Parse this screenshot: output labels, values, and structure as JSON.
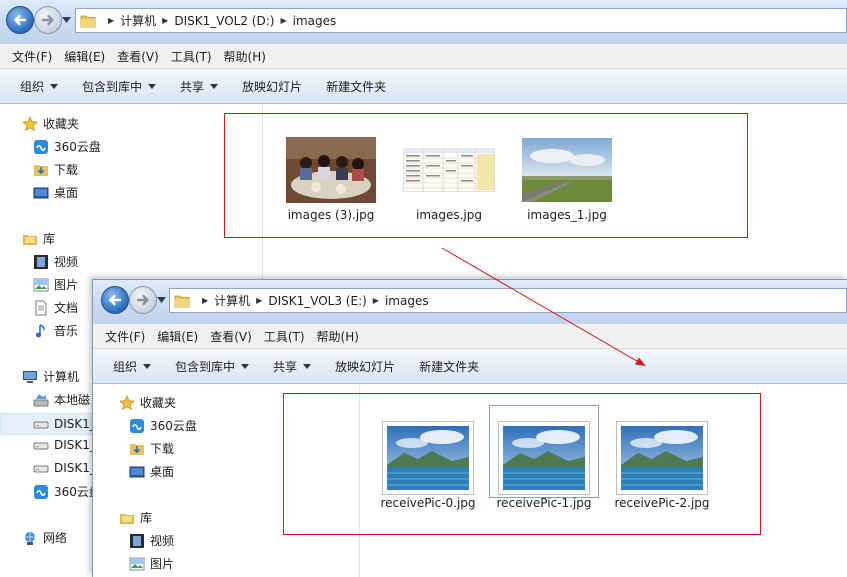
{
  "colors": {
    "annotation_red": "#cc1c1c",
    "title_blue": "#c9dbef",
    "selection_blue": "#e5f0fb"
  },
  "back_window": {
    "breadcrumb": [
      "计算机",
      "DISK1_VOL2 (D:)",
      "images"
    ],
    "menu": [
      "文件(F)",
      "编辑(E)",
      "查看(V)",
      "工具(T)",
      "帮助(H)"
    ],
    "toolbar": [
      "组织",
      "包含到库中",
      "共享",
      "放映幻灯片",
      "新建文件夹"
    ],
    "nav": {
      "favorites": "收藏夹",
      "cloud": "360云盘",
      "downloads": "下载",
      "desktop": "桌面",
      "libraries": "库",
      "videos": "视频",
      "pictures": "图片",
      "documents": "文档",
      "music": "音乐",
      "computer": "计算机",
      "local_disk": "本地磁",
      "disk1_a": "DISK1_",
      "disk1_b": "DISK1_",
      "disk1_c": "DISK1_",
      "cloud2": "360云盘",
      "network": "网络"
    },
    "files": [
      "images (3).jpg",
      "images.jpg",
      "images_1.jpg"
    ]
  },
  "front_window": {
    "breadcrumb": [
      "计算机",
      "DISK1_VOL3 (E:)",
      "images"
    ],
    "menu": [
      "文件(F)",
      "编辑(E)",
      "查看(V)",
      "工具(T)",
      "帮助(H)"
    ],
    "toolbar": [
      "组织",
      "包含到库中",
      "共享",
      "放映幻灯片",
      "新建文件夹"
    ],
    "nav": {
      "favorites": "收藏夹",
      "cloud": "360云盘",
      "downloads": "下载",
      "desktop": "桌面",
      "libraries": "库",
      "videos": "视频",
      "pictures": "图片"
    },
    "files": [
      "receivePic-0.jpg",
      "receivePic-1.jpg",
      "receivePic-2.jpg"
    ]
  },
  "icons": [
    "back-arrow-icon",
    "forward-arrow-icon",
    "folder-icon",
    "star-icon",
    "cloud-icon",
    "download-folder-icon",
    "desktop-icon",
    "library-icon",
    "video-icon",
    "picture-icon",
    "document-icon",
    "music-icon",
    "computer-icon",
    "drive-icon",
    "network-icon"
  ]
}
